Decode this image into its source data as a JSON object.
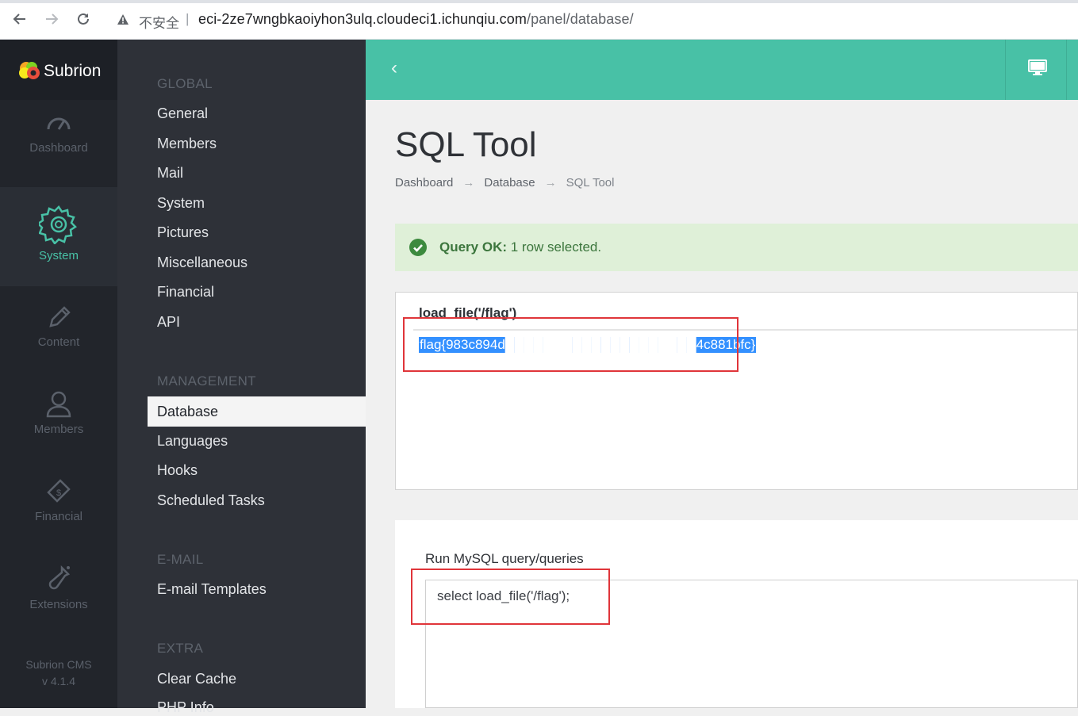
{
  "browser": {
    "insecure_label": "不安全",
    "separator": "|",
    "url_host": "eci-2ze7wngbkaoiyhon3ulq.cloudeci1.ichunqiu.com",
    "url_path": "/panel/database/"
  },
  "app": {
    "name": "Subrion",
    "version_line1": "Subrion CMS",
    "version_line2": "v 4.1.4",
    "accent_color": "#48c1a6"
  },
  "icon_nav": [
    {
      "label": "Dashboard",
      "icon": "gauge-icon"
    },
    {
      "label": "System",
      "icon": "gear-icon",
      "active": true
    },
    {
      "label": "Content",
      "icon": "pencil-icon"
    },
    {
      "label": "Members",
      "icon": "user-icon"
    },
    {
      "label": "Financial",
      "icon": "money-icon"
    },
    {
      "label": "Extensions",
      "icon": "flask-icon"
    }
  ],
  "submenu": {
    "global_heading": "GLOBAL",
    "global_items": [
      "General",
      "Members",
      "Mail",
      "System",
      "Pictures",
      "Miscellaneous",
      "Financial",
      "API"
    ],
    "management_heading": "MANAGEMENT",
    "management_items": [
      "Database",
      "Languages",
      "Hooks",
      "Scheduled Tasks"
    ],
    "email_heading": "E-MAIL",
    "email_items": [
      "E-mail Templates"
    ],
    "extra_heading": "EXTRA",
    "extra_items": [
      "Clear Cache",
      "PHP Info"
    ]
  },
  "page": {
    "title": "SQL Tool",
    "breadcrumb": [
      "Dashboard",
      "Database",
      "SQL Tool"
    ],
    "breadcrumb_arrow": "→"
  },
  "alert": {
    "strong": "Query OK:",
    "text": " 1 row selected."
  },
  "result": {
    "column": "load_file('/flag')",
    "value": "flag{983c894d████████████████████4c881bfc}"
  },
  "query": {
    "label": "Run MySQL query/queries",
    "value": "select load_file('/flag');"
  }
}
